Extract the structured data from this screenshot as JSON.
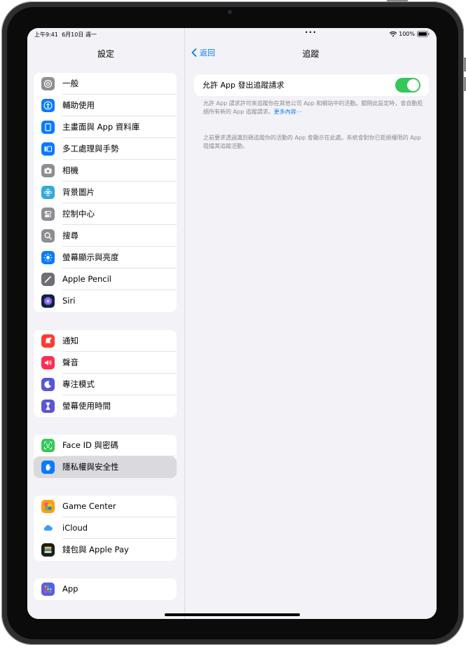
{
  "status": {
    "time": "上午9:41",
    "date": "6月10日 週一",
    "dots": "•••",
    "battery": "100%"
  },
  "sidebar": {
    "title": "設定",
    "groups": [
      [
        {
          "label": "一般",
          "icon": "gear-icon",
          "color": "#8e8e93"
        },
        {
          "label": "輔助使用",
          "icon": "accessibility-icon",
          "color": "#0a7aff"
        },
        {
          "label": "主畫面與 App 資料庫",
          "icon": "home-screen-icon",
          "color": "#0a7aff"
        },
        {
          "label": "多工處理與手勢",
          "icon": "multitasking-icon",
          "color": "#0a7aff"
        },
        {
          "label": "相機",
          "icon": "camera-icon",
          "color": "#8e8e93"
        },
        {
          "label": "背景圖片",
          "icon": "wallpaper-icon",
          "color": "#34aadc"
        },
        {
          "label": "控制中心",
          "icon": "control-center-icon",
          "color": "#8e8e93"
        },
        {
          "label": "搜尋",
          "icon": "search-icon",
          "color": "#8e8e93"
        },
        {
          "label": "螢幕顯示與亮度",
          "icon": "brightness-icon",
          "color": "#0a7aff"
        },
        {
          "label": "Apple Pencil",
          "icon": "pencil-icon",
          "color": "#6e6e73"
        },
        {
          "label": "Siri",
          "icon": "siri-icon",
          "color": "#1c1c3a"
        }
      ],
      [
        {
          "label": "通知",
          "icon": "notifications-icon",
          "color": "#ff3b30"
        },
        {
          "label": "聲音",
          "icon": "sound-icon",
          "color": "#ff2d55"
        },
        {
          "label": "專注模式",
          "icon": "focus-moon-icon",
          "color": "#5856d6"
        },
        {
          "label": "螢幕使用時間",
          "icon": "hourglass-icon",
          "color": "#5856d6"
        }
      ],
      [
        {
          "label": "Face ID 與密碼",
          "icon": "face-id-icon",
          "color": "#34c759"
        },
        {
          "label": "隱私權與安全性",
          "icon": "privacy-hand-icon",
          "color": "#0a7aff",
          "selected": true
        }
      ],
      [
        {
          "label": "Game Center",
          "icon": "game-center-icon",
          "color": "#ff9f0a"
        },
        {
          "label": "iCloud",
          "icon": "icloud-icon",
          "color": "#ffffff"
        },
        {
          "label": "錢包與 Apple Pay",
          "icon": "wallet-icon",
          "color": "#1c1c1e"
        }
      ],
      [
        {
          "label": "App",
          "icon": "apps-grid-icon",
          "color": "#5e5ce6"
        }
      ]
    ]
  },
  "detail": {
    "back_label": "返回",
    "title": "追蹤",
    "toggle_label": "允許 App 發出追蹤請求",
    "toggle_on": true,
    "footer1_text": "允許 App 請求許可來追蹤你在其他公司 App 和網站中的活動。關閉此設定時，會自動拒絕所有新的 App 追蹤請求。",
    "footer1_link": "更多內容⋯",
    "footer2_text": "之前要求透過識別碼追蹤你的活動的 App 會顯示在此處。系統會對你已拒絕權限的 App 阻擋其追蹤活動。"
  }
}
